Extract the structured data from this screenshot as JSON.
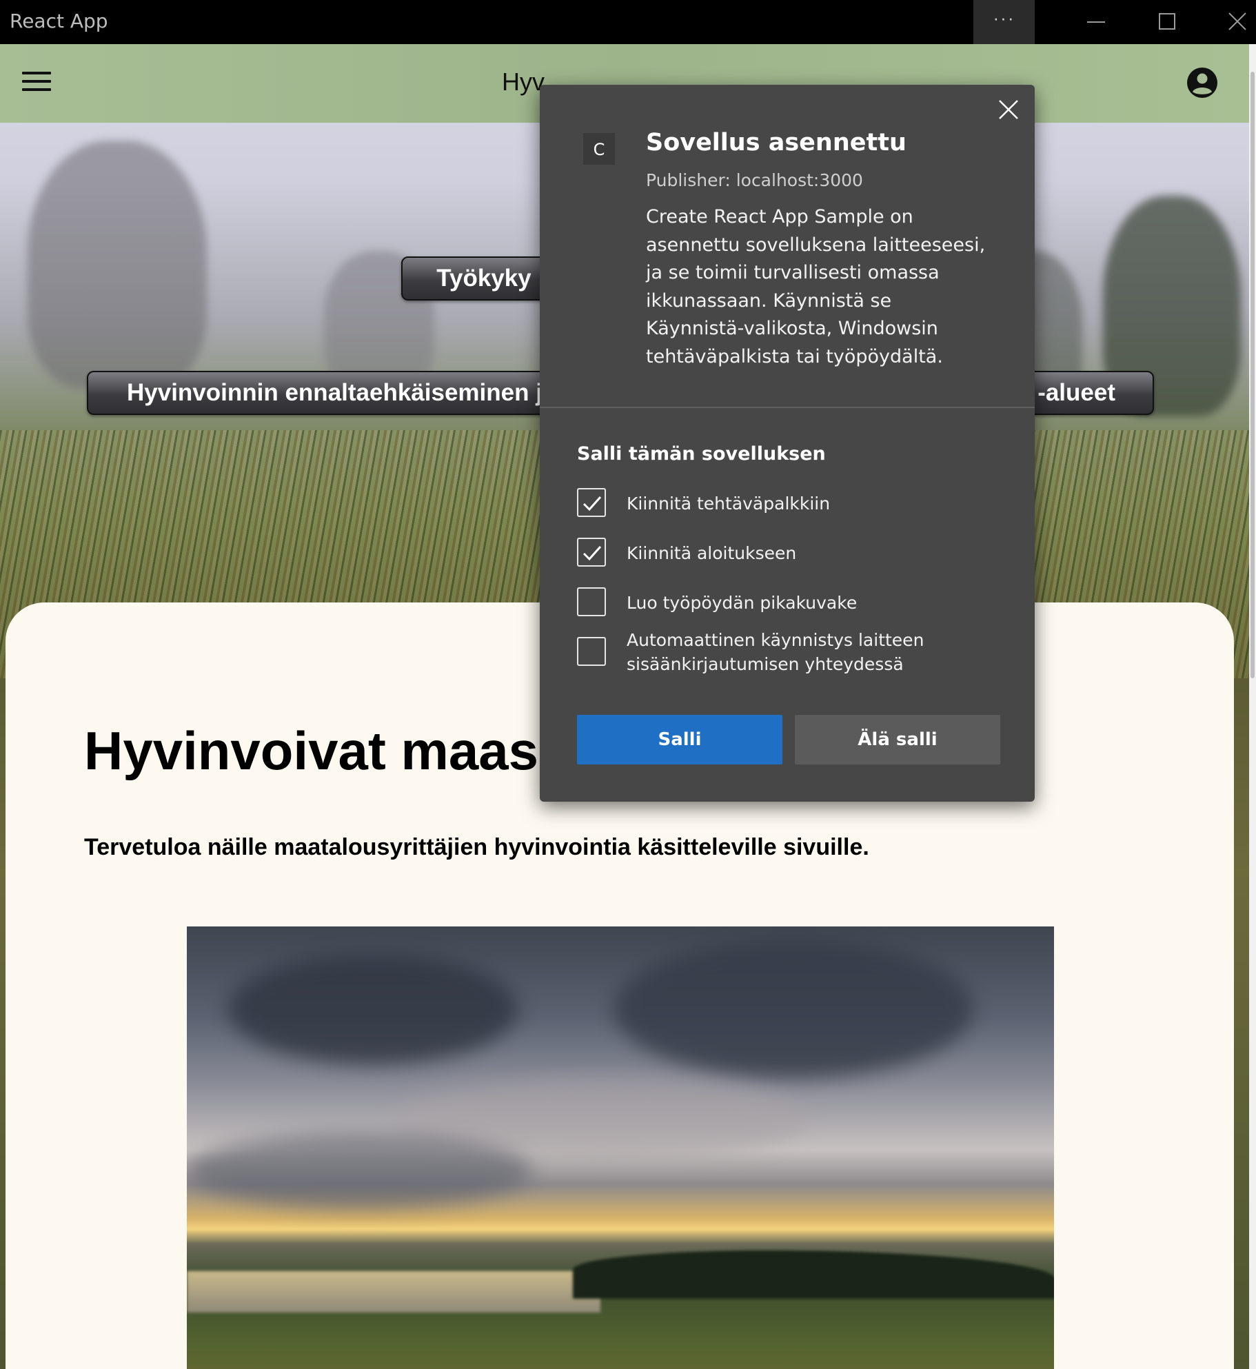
{
  "window": {
    "title": "React App",
    "more_glyph": "···"
  },
  "header": {
    "title_visible": "Hyv"
  },
  "hero": {
    "chip_top": "Työkyky",
    "chip_wide_left": "Hyvinvoinnin ennaltaehkäiseminen ja",
    "chip_wide_right": "-alueet"
  },
  "content": {
    "heading_visible": "Hyvinvoivat maase",
    "lead": "Tervetuloa näille maatalousyrittäjien hyvinvointia käsitteleville sivuille."
  },
  "dialog": {
    "app_icon_letter": "C",
    "title": "Sovellus asennettu",
    "publisher": "Publisher: localhost:3000",
    "description": "Create React App Sample on asennettu sovelluksena laitteeseesi, ja se toimii turvallisesti omassa ikkunassaan. Käynnistä se Käynnistä-valikosta, Windowsin tehtäväpalkista tai työpöydältä.",
    "allow_heading": "Salli tämän sovelluksen",
    "options": [
      {
        "label": "Kiinnitä tehtäväpalkkiin",
        "checked": true
      },
      {
        "label": "Kiinnitä aloitukseen",
        "checked": true
      },
      {
        "label": "Luo työpöydän pikakuvake",
        "checked": false
      },
      {
        "label": "Automaattinen käynnistys laitteen sisäänkirjautumisen yhteydessä",
        "checked": false
      }
    ],
    "allow_button": "Salli",
    "deny_button": "Älä salli"
  },
  "colors": {
    "header_bg": "#a7bd94",
    "dialog_bg": "#474747",
    "primary_button": "#1f6fc5",
    "card_bg": "#fdf9f0"
  },
  "icons": [
    "hamburger-menu-icon",
    "account-circle-icon",
    "close-icon",
    "checkmark-icon",
    "minimize-icon",
    "maximize-icon"
  ]
}
